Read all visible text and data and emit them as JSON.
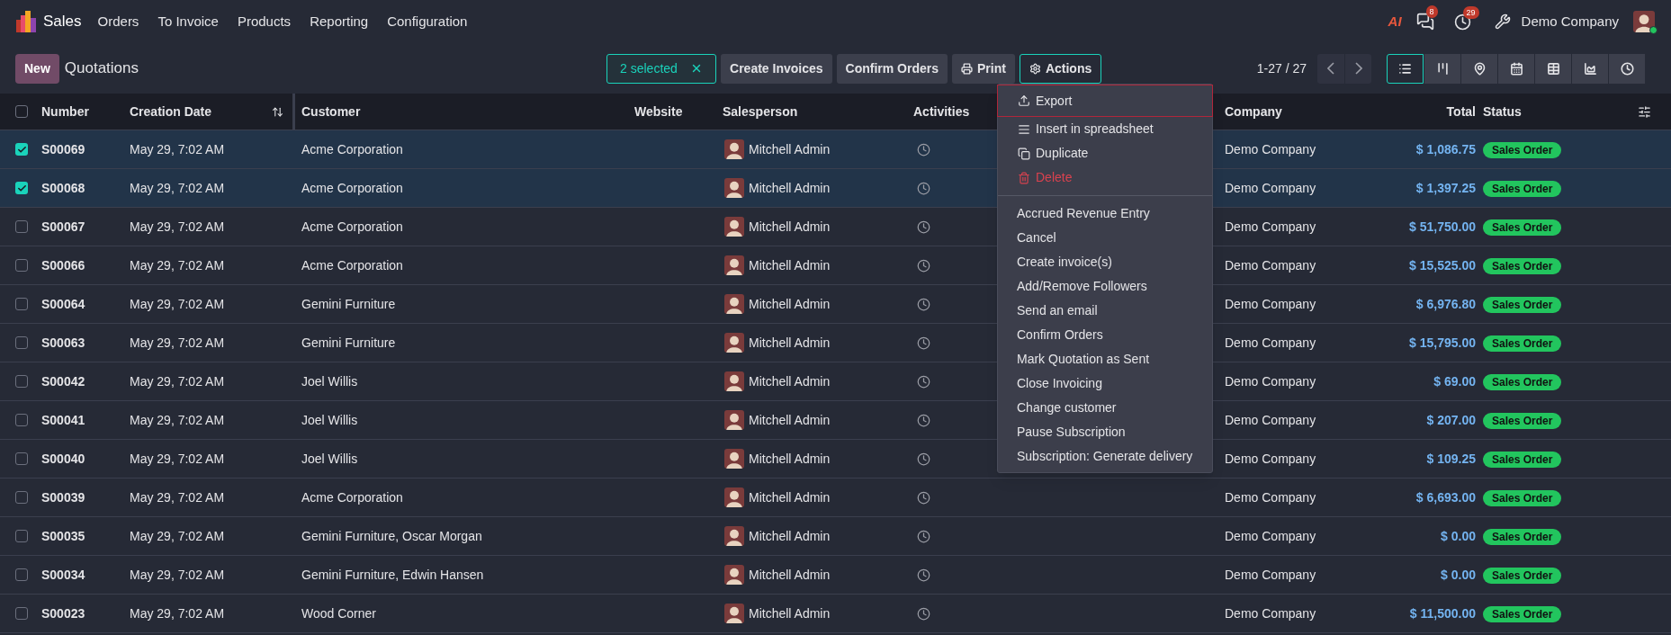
{
  "app": {
    "name": "Sales"
  },
  "menu": [
    "Orders",
    "To Invoice",
    "Products",
    "Reporting",
    "Configuration"
  ],
  "systray": {
    "ai_label": "AI",
    "chat_count": "8",
    "activity_count": "29",
    "company": "Demo Company"
  },
  "control_panel": {
    "new_button": "New",
    "title": "Quotations",
    "selection": "2 selected",
    "pager": "1-27 / 27"
  },
  "action_buttons": [
    {
      "label": "Create Invoices",
      "kind": "plain",
      "expanded": false
    },
    {
      "label": "Confirm Orders",
      "kind": "plain",
      "expanded": false
    },
    {
      "label": "Print",
      "kind": "print",
      "expanded": false
    },
    {
      "label": "Actions",
      "kind": "actions",
      "expanded": true
    }
  ],
  "views": [
    {
      "kind": "list",
      "selected": true
    },
    {
      "kind": "kanban",
      "selected": false
    },
    {
      "kind": "map",
      "selected": false
    },
    {
      "kind": "calendar",
      "selected": false
    },
    {
      "kind": "pivot",
      "selected": false
    },
    {
      "kind": "graph",
      "selected": false
    },
    {
      "kind": "activity",
      "selected": false
    }
  ],
  "table": {
    "all_checked": false,
    "columns": [
      "Number",
      "Creation Date",
      "Customer",
      "Website",
      "Salesperson",
      "Activities",
      "Company",
      "Total",
      "Status"
    ],
    "rows": [
      {
        "number": "S00069",
        "date": "May 29, 7:02 AM",
        "customer": "Acme Corporation",
        "salesperson": "Mitchell Admin",
        "company": "Demo Company",
        "total": "$ 1,086.75",
        "status": "Sales Order",
        "selected": true
      },
      {
        "number": "S00068",
        "date": "May 29, 7:02 AM",
        "customer": "Acme Corporation",
        "salesperson": "Mitchell Admin",
        "company": "Demo Company",
        "total": "$ 1,397.25",
        "status": "Sales Order",
        "selected": true
      },
      {
        "number": "S00067",
        "date": "May 29, 7:02 AM",
        "customer": "Acme Corporation",
        "salesperson": "Mitchell Admin",
        "company": "Demo Company",
        "total": "$ 51,750.00",
        "status": "Sales Order",
        "selected": false
      },
      {
        "number": "S00066",
        "date": "May 29, 7:02 AM",
        "customer": "Acme Corporation",
        "salesperson": "Mitchell Admin",
        "company": "Demo Company",
        "total": "$ 15,525.00",
        "status": "Sales Order",
        "selected": false
      },
      {
        "number": "S00064",
        "date": "May 29, 7:02 AM",
        "customer": "Gemini Furniture",
        "salesperson": "Mitchell Admin",
        "company": "Demo Company",
        "total": "$ 6,976.80",
        "status": "Sales Order",
        "selected": false
      },
      {
        "number": "S00063",
        "date": "May 29, 7:02 AM",
        "customer": "Gemini Furniture",
        "salesperson": "Mitchell Admin",
        "company": "Demo Company",
        "total": "$ 15,795.00",
        "status": "Sales Order",
        "selected": false
      },
      {
        "number": "S00042",
        "date": "May 29, 7:02 AM",
        "customer": "Joel Willis",
        "salesperson": "Mitchell Admin",
        "company": "Demo Company",
        "total": "$ 69.00",
        "status": "Sales Order",
        "selected": false
      },
      {
        "number": "S00041",
        "date": "May 29, 7:02 AM",
        "customer": "Joel Willis",
        "salesperson": "Mitchell Admin",
        "company": "Demo Company",
        "total": "$ 207.00",
        "status": "Sales Order",
        "selected": false
      },
      {
        "number": "S00040",
        "date": "May 29, 7:02 AM",
        "customer": "Joel Willis",
        "salesperson": "Mitchell Admin",
        "company": "Demo Company",
        "total": "$ 109.25",
        "status": "Sales Order",
        "selected": false
      },
      {
        "number": "S00039",
        "date": "May 29, 7:02 AM",
        "customer": "Acme Corporation",
        "salesperson": "Mitchell Admin",
        "company": "Demo Company",
        "total": "$ 6,693.00",
        "status": "Sales Order",
        "selected": false
      },
      {
        "number": "S00035",
        "date": "May 29, 7:02 AM",
        "customer": "Gemini Furniture, Oscar Morgan",
        "salesperson": "Mitchell Admin",
        "company": "Demo Company",
        "total": "$ 0.00",
        "status": "Sales Order",
        "selected": false
      },
      {
        "number": "S00034",
        "date": "May 29, 7:02 AM",
        "customer": "Gemini Furniture, Edwin Hansen",
        "salesperson": "Mitchell Admin",
        "company": "Demo Company",
        "total": "$ 0.00",
        "status": "Sales Order",
        "selected": false
      },
      {
        "number": "S00023",
        "date": "May 29, 7:02 AM",
        "customer": "Wood Corner",
        "salesperson": "Mitchell Admin",
        "company": "Demo Company",
        "total": "$ 11,500.00",
        "status": "Sales Order",
        "selected": false
      }
    ]
  },
  "actions_menu": {
    "groups": [
      [
        {
          "label": "Export",
          "kind": "export",
          "highlighted": true
        },
        {
          "label": "Insert in spreadsheet",
          "kind": "spreadsheet",
          "highlighted": false
        },
        {
          "label": "Duplicate",
          "kind": "duplicate",
          "highlighted": false
        },
        {
          "label": "Delete",
          "kind": "delete",
          "highlighted": false
        }
      ],
      [
        {
          "label": "Accrued Revenue Entry",
          "kind": "plain",
          "highlighted": false
        },
        {
          "label": "Cancel",
          "kind": "plain",
          "highlighted": false
        },
        {
          "label": "Create invoice(s)",
          "kind": "plain",
          "highlighted": false
        },
        {
          "label": "Add/Remove Followers",
          "kind": "plain",
          "highlighted": false
        },
        {
          "label": "Send an email",
          "kind": "plain",
          "highlighted": false
        },
        {
          "label": "Confirm Orders",
          "kind": "plain",
          "highlighted": false
        },
        {
          "label": "Mark Quotation as Sent",
          "kind": "plain",
          "highlighted": false
        },
        {
          "label": "Close Invoicing",
          "kind": "plain",
          "highlighted": false
        },
        {
          "label": "Change customer",
          "kind": "plain",
          "highlighted": false
        },
        {
          "label": "Pause Subscription",
          "kind": "plain",
          "highlighted": false
        },
        {
          "label": "Subscription: Generate delivery",
          "kind": "plain",
          "highlighted": false
        }
      ]
    ]
  }
}
